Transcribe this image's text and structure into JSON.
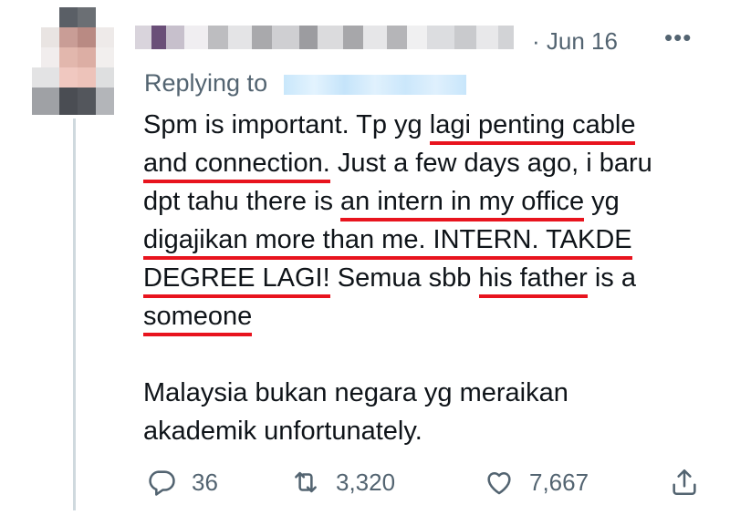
{
  "tweet": {
    "date_sep": "·",
    "date": "Jun 16",
    "more": "•••",
    "replying_to": "Replying to",
    "lines": [
      [
        "Spm is important. Tp yg ",
        {
          "m": "lagi penting cable"
        }
      ],
      [
        {
          "m": "and connection."
        },
        " Just a few days ago, i baru"
      ],
      [
        "dpt tahu there is ",
        {
          "m": "an intern in my office"
        },
        " yg"
      ],
      [
        {
          "m": "digajikan more than me. INTERN. TAKDE"
        }
      ],
      [
        {
          "m": "DEGREE LAGI!"
        },
        " Semua sbb ",
        {
          "m": "his father"
        },
        " is a"
      ],
      [
        {
          "m": "someone"
        }
      ]
    ],
    "paragraph2": [
      "Malaysia bukan negara yg meraikan",
      "akademik unfortunately."
    ]
  },
  "actions": {
    "replies": "36",
    "retweets": "3,320",
    "likes": "7,667"
  },
  "icons": {
    "reply": "reply-icon",
    "retweet": "retweet-icon",
    "like": "heart-icon",
    "share": "share-icon"
  },
  "colors": {
    "underline": "#e8141e",
    "muted": "#536471",
    "text": "#0f1419"
  }
}
